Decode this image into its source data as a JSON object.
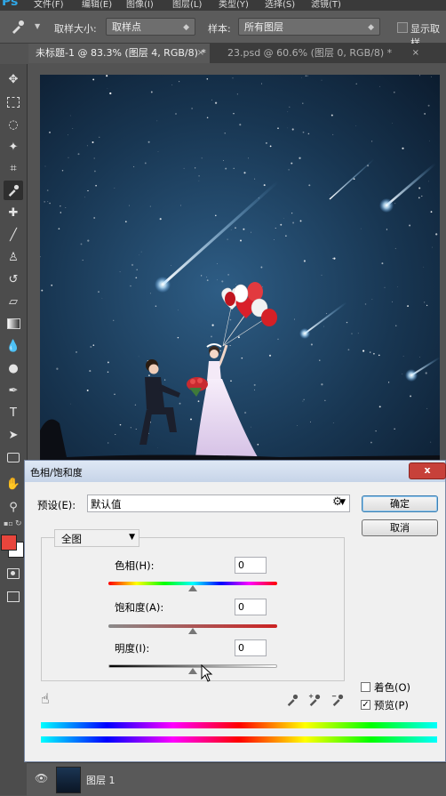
{
  "app": {
    "logo": "Ps"
  },
  "menu": [
    "文件(F)",
    "编辑(E)",
    "图像(I)",
    "图层(L)",
    "类型(Y)",
    "选择(S)",
    "滤镜(T)"
  ],
  "options": {
    "sample_size_label": "取样大小:",
    "sample_size_value": "取样点",
    "sample_label": "样本:",
    "sample_value": "所有图层",
    "show_ring_label": "显示取样"
  },
  "tabs": [
    {
      "label": "未标题-1 @ 83.3% (图层 4, RGB/8) *",
      "close": "×"
    },
    {
      "label": "23.psd @ 60.6% (图层 0, RGB/8) *",
      "close": "×"
    }
  ],
  "colors": {
    "foreground": "#e8453c",
    "background": "#ffffff",
    "accent": "#2fa8e8"
  },
  "dialog": {
    "title": "色相/饱和度",
    "close": "x",
    "preset_label": "预设(E):",
    "preset_value": "默认值",
    "ok": "确定",
    "cancel": "取消",
    "channel": "全图",
    "hue_label": "色相(H):",
    "hue_value": "0",
    "saturation_label": "饱和度(A):",
    "saturation_value": "0",
    "lightness_label": "明度(I):",
    "lightness_value": "0",
    "colorize_label": "着色(O)",
    "colorize_checked": false,
    "preview_label": "预览(P)",
    "preview_checked": true,
    "check_mark": "✓"
  },
  "layers": {
    "name": "图层 1"
  }
}
